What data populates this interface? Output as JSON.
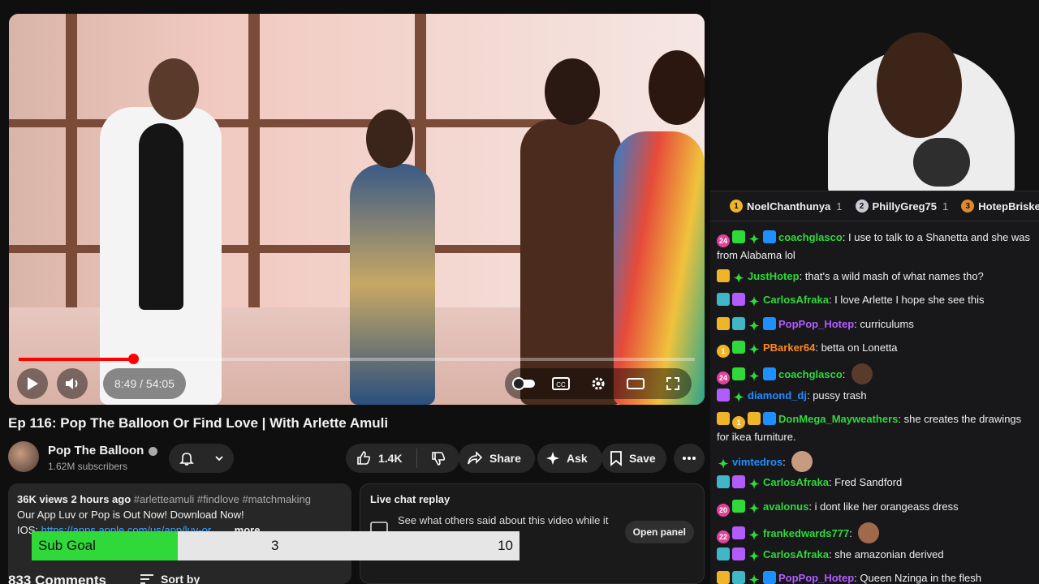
{
  "video": {
    "title": "Ep 116: Pop The Balloon Or Find Love | With Arlette Amuli",
    "time": "8:49 / 54:05",
    "progress": 0.169
  },
  "channel": {
    "name": "Pop The Balloon",
    "subscribers": "1.62M subscribers"
  },
  "actions": {
    "likes": "1.4K",
    "share": "Share",
    "ask": "Ask",
    "save": "Save"
  },
  "description": {
    "views_time": "36K views  2 hours ago",
    "tags": "#arletteamuli #findlove #matchmaking",
    "line2": "Our App Luv or Pop is Out Now! Download Now!",
    "line3_prefix": "IOS: ",
    "line3_link": "https://apps.apple.com/us/app/luv-or",
    "more": "...more"
  },
  "live_chat": {
    "title": "Live chat replay",
    "text": "See what others said about this video while it",
    "button": "Open panel"
  },
  "comments": {
    "count": "833 Comments",
    "sort": "Sort by"
  },
  "sub_goal": {
    "label": "Sub Goal",
    "current": "3",
    "goal": "10",
    "fraction": 0.3
  },
  "leaderboard": [
    {
      "rank": "1",
      "name": "NoelChanthunya",
      "score": "1",
      "color": "#f0b429"
    },
    {
      "rank": "2",
      "name": "PhillyGreg75",
      "score": "1",
      "color": "#c9c9d1"
    },
    {
      "rank": "3",
      "name": "HotepBrisketA",
      "score": "",
      "color": "#e08a2c"
    }
  ],
  "chat": [
    {
      "user": "coachglasco",
      "color": "#2fd93a",
      "text": "I use to talk to a Shanetta and she was from Alabama lol"
    },
    {
      "user": "JustHotep",
      "color": "#2fd93a",
      "text": "that's a wild mash of what names tho?"
    },
    {
      "user": "CarlosAfraka",
      "color": "#2fd93a",
      "text": "I love Arlette I hope she see this"
    },
    {
      "user": "PopPop_Hotep",
      "color": "#b25cff",
      "text": "curriculums"
    },
    {
      "user": "PBarker64",
      "color": "#ff8a1e",
      "text": "betta on Lonetta"
    },
    {
      "user": "coachglasco",
      "color": "#2fd93a",
      "text": ""
    },
    {
      "user": "diamond_dj",
      "color": "#1e90ff",
      "text": "pussy trash"
    },
    {
      "user": "DonMega_Mayweathers",
      "color": "#2fd93a",
      "text": "she creates the drawings for ikea furniture."
    },
    {
      "user": "vimtedros",
      "color": "#1e90ff",
      "text": ""
    },
    {
      "user": "CarlosAfraka",
      "color": "#2fd93a",
      "text": "Fred Sandford"
    },
    {
      "user": "avalonus",
      "color": "#2fd93a",
      "text": "i dont like her orangeass dress"
    },
    {
      "user": "frankedwards777",
      "color": "#2fd93a",
      "text": ""
    },
    {
      "user": "CarlosAfraka",
      "color": "#2fd93a",
      "text": "she amazonian derived"
    },
    {
      "user": "PopPop_Hotep",
      "color": "#b25cff",
      "text": "Queen Nzinga in the flesh"
    }
  ]
}
